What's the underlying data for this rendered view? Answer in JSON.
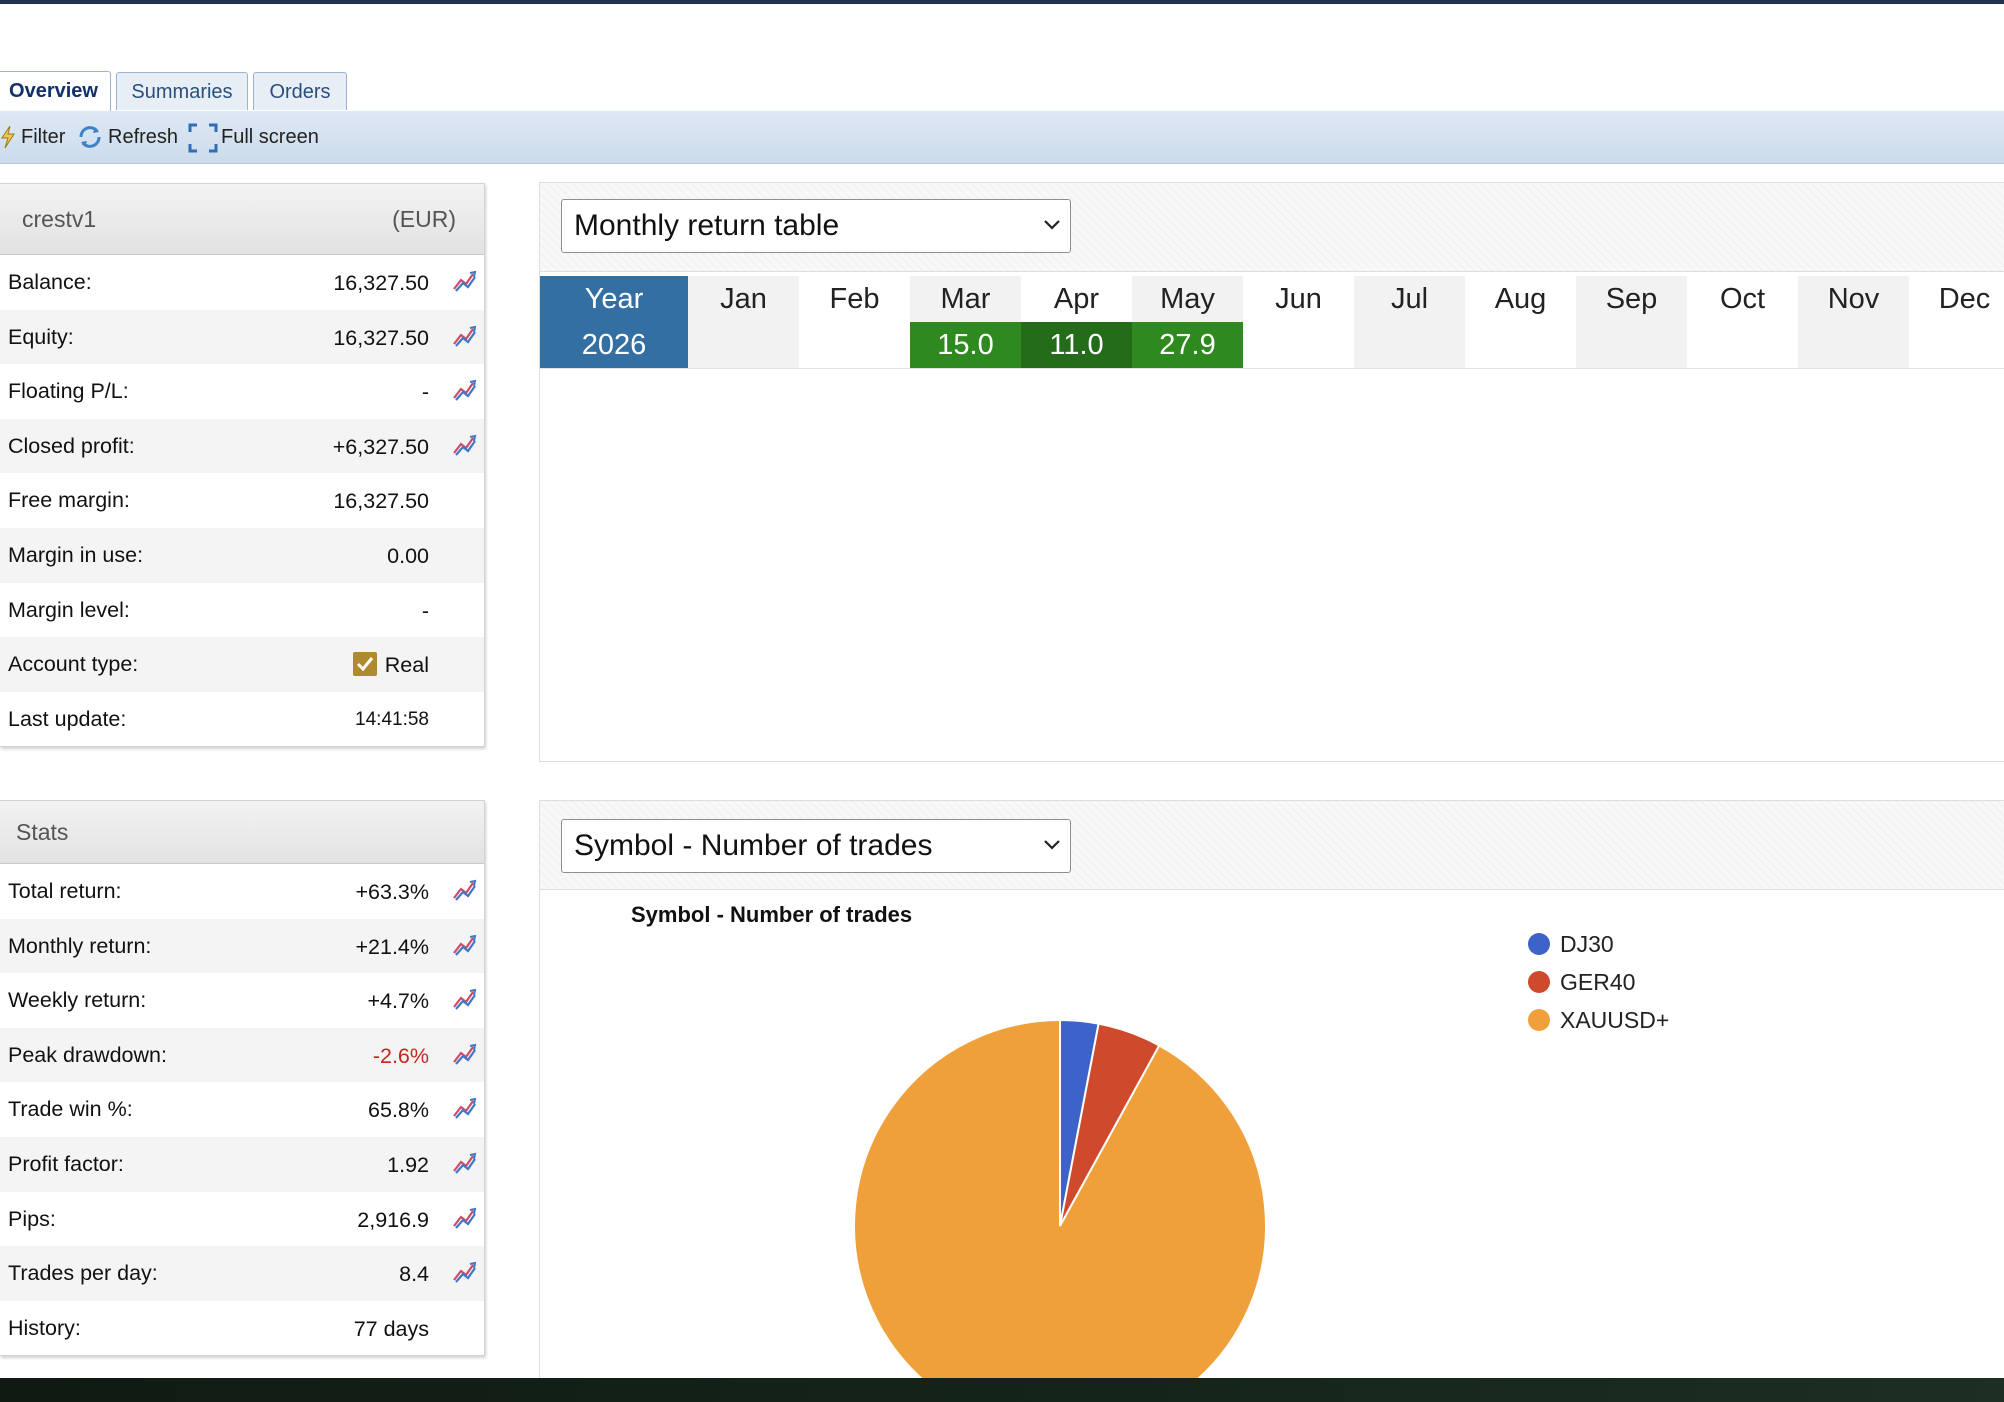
{
  "tabs": [
    {
      "label": "Overview",
      "active": true
    },
    {
      "label": "Summaries",
      "active": false
    },
    {
      "label": "Orders",
      "active": false
    }
  ],
  "toolbar": {
    "filter": "Filter",
    "refresh": "Refresh",
    "fullscreen": "Full screen"
  },
  "account": {
    "name": "crestv1",
    "currency": "(EUR)",
    "rows": [
      {
        "label": "Balance:",
        "value": "16,327.50",
        "chart": true
      },
      {
        "label": "Equity:",
        "value": "16,327.50",
        "chart": true
      },
      {
        "label": "Floating P/L:",
        "value": "-",
        "chart": true
      },
      {
        "label": "Closed profit:",
        "value": "+6,327.50",
        "chart": true
      },
      {
        "label": "Free margin:",
        "value": "16,327.50",
        "chart": false
      },
      {
        "label": "Margin in use:",
        "value": "0.00",
        "chart": false
      },
      {
        "label": "Margin level:",
        "value": "-",
        "chart": false
      },
      {
        "label": "Account type:",
        "value": "Real",
        "chart": false,
        "checkbox": true
      },
      {
        "label": "Last update:",
        "value": "14:41:58",
        "chart": false,
        "small": true
      }
    ]
  },
  "stats": {
    "title": "Stats",
    "rows": [
      {
        "label": "Total return:",
        "value": "+63.3%",
        "chart": true
      },
      {
        "label": "Monthly return:",
        "value": "+21.4%",
        "chart": true
      },
      {
        "label": "Weekly return:",
        "value": "+4.7%",
        "chart": true
      },
      {
        "label": "Peak drawdown:",
        "value": "-2.6%",
        "chart": true,
        "negative": true
      },
      {
        "label": "Trade win %:",
        "value": "65.8%",
        "chart": true
      },
      {
        "label": "Profit factor:",
        "value": "1.92",
        "chart": true
      },
      {
        "label": "Pips:",
        "value": "2,916.9",
        "chart": true
      },
      {
        "label": "Trades per day:",
        "value": "8.4",
        "chart": true
      },
      {
        "label": "History:",
        "value": "77 days",
        "chart": false
      }
    ]
  },
  "monthly": {
    "select_label": "Monthly return table",
    "year_header": "Year",
    "months": [
      "Jan",
      "Feb",
      "Mar",
      "Apr",
      "May",
      "Jun",
      "Jul",
      "Aug",
      "Sep",
      "Oct",
      "Nov",
      "Dec"
    ],
    "rows": [
      {
        "year": "2026",
        "values": [
          "",
          "",
          "15.0",
          "11.0",
          "27.9",
          "",
          "",
          "",
          "",
          "",
          "",
          ""
        ]
      }
    ]
  },
  "symbol_chart": {
    "select_label": "Symbol - Number of trades"
  },
  "chart_data": {
    "type": "pie",
    "title": "Symbol - Number of trades",
    "labels": [
      "DJ30",
      "GER40",
      "XAUUSD+"
    ],
    "values": [
      3,
      5,
      92
    ],
    "colors": [
      "#3d63c9",
      "#cf4a2c",
      "#f0a03a"
    ],
    "slice_labels": [
      "",
      "",
      "92%"
    ],
    "legend_position": "right"
  },
  "colors": {
    "accent_blue": "#336fa3",
    "positive_green": "#2e8a1e",
    "negative_red": "#c8261d"
  }
}
